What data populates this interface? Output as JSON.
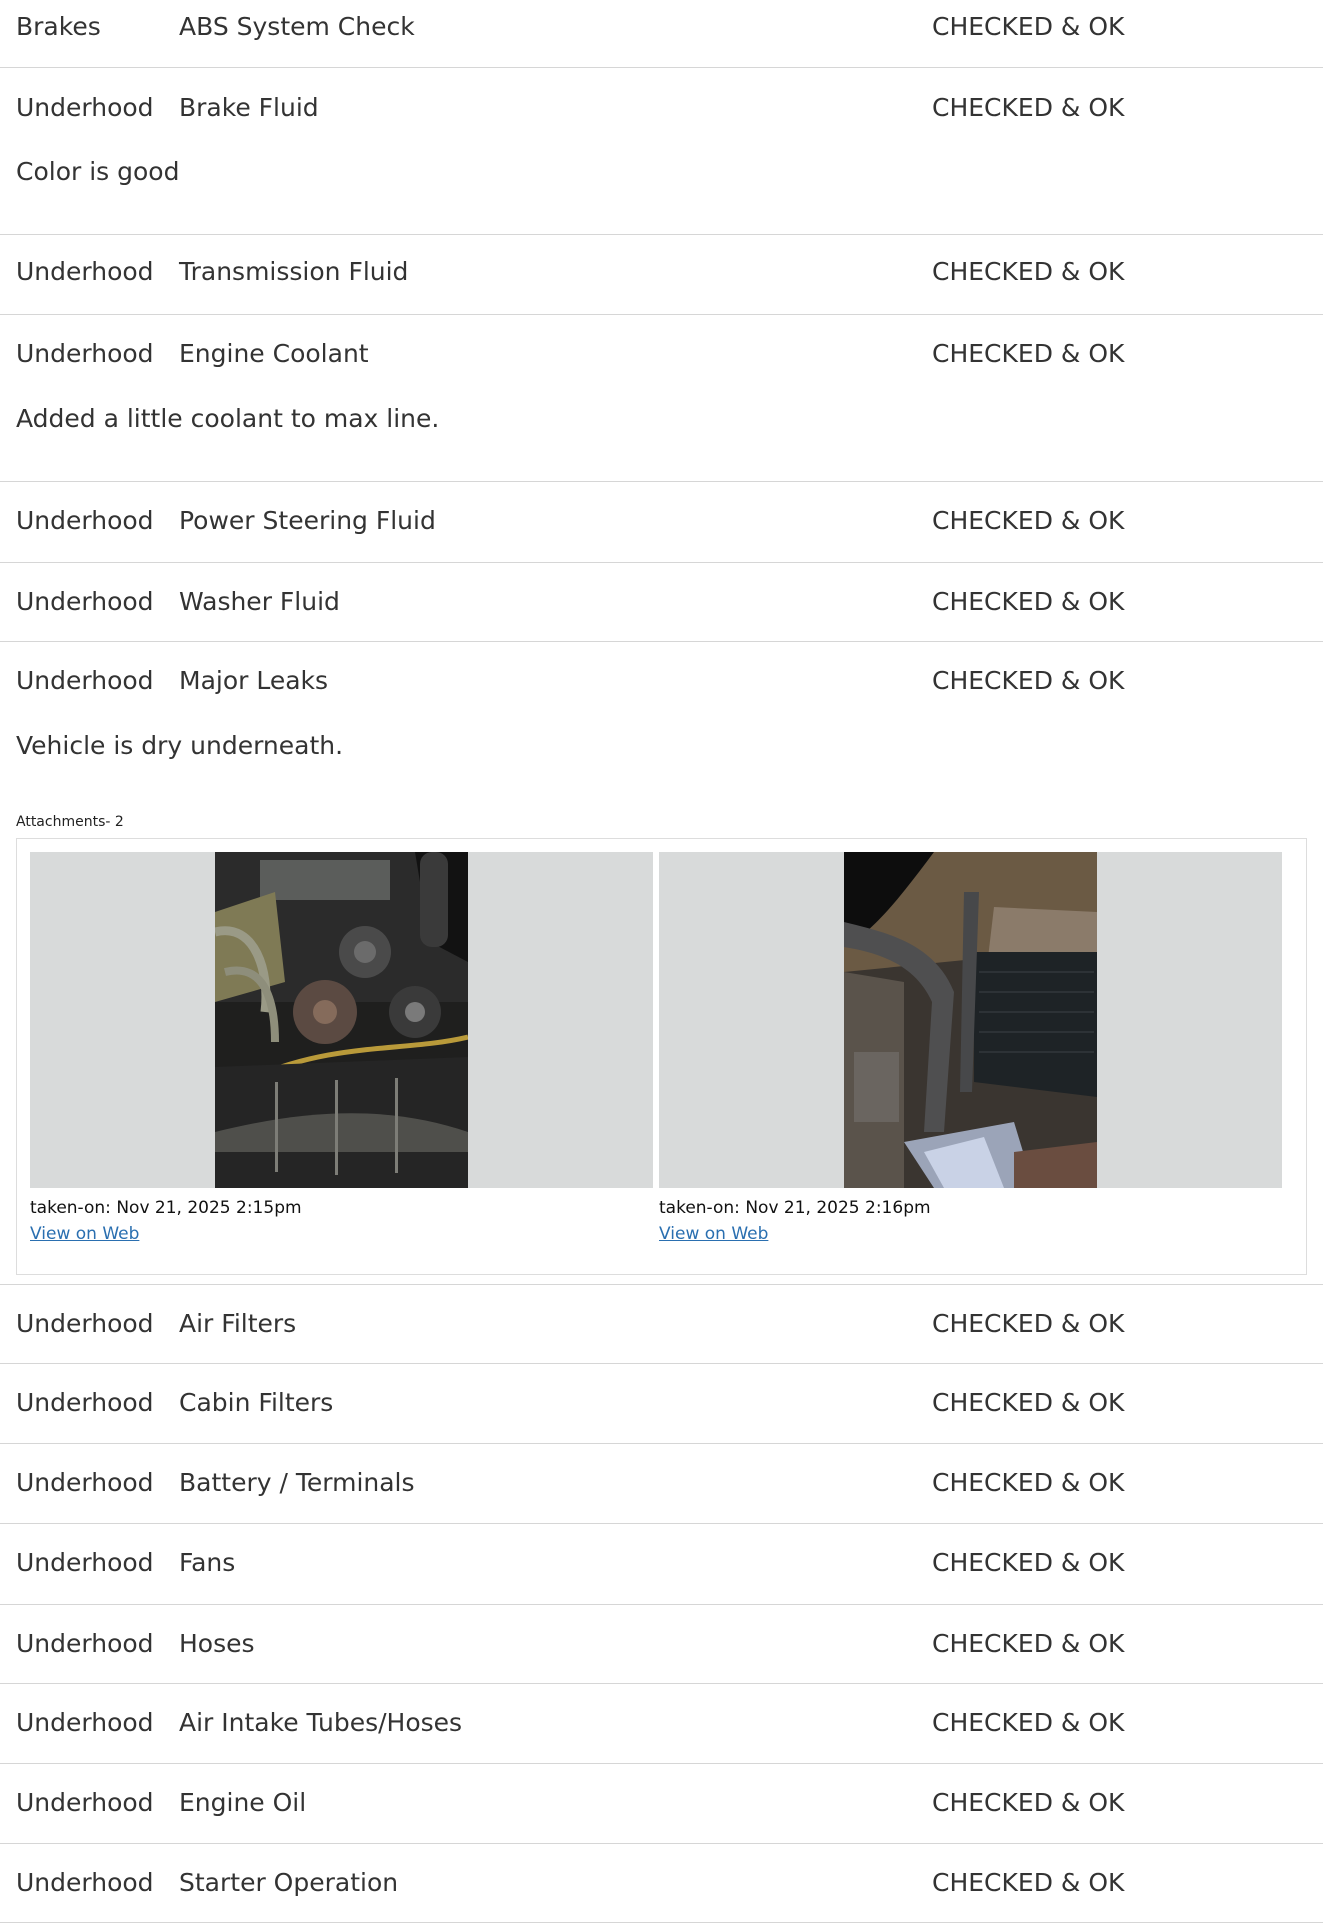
{
  "rows_top": [
    {
      "category": "Brakes",
      "item": "ABS System Check",
      "status": "CHECKED & OK",
      "note": ""
    },
    {
      "category": "Underhood",
      "item": "Brake Fluid",
      "status": "CHECKED & OK",
      "note": "Color is good"
    },
    {
      "category": "Underhood",
      "item": "Transmission Fluid",
      "status": "CHECKED & OK",
      "note": ""
    },
    {
      "category": "Underhood",
      "item": "Engine Coolant",
      "status": "CHECKED & OK",
      "note": "Added a little coolant to max line."
    },
    {
      "category": "Underhood",
      "item": "Power Steering Fluid",
      "status": "CHECKED & OK",
      "note": ""
    },
    {
      "category": "Underhood",
      "item": "Washer Fluid",
      "status": "CHECKED & OK",
      "note": ""
    },
    {
      "category": "Underhood",
      "item": "Major Leaks",
      "status": "CHECKED & OK",
      "note": "Vehicle is dry underneath."
    }
  ],
  "attachments": {
    "label": "Attachments- 2",
    "items": [
      {
        "taken_label": "taken-on:",
        "taken_value": "Nov 21, 2025 2:15pm",
        "link_text": "View on Web"
      },
      {
        "taken_label": "taken-on:",
        "taken_value": "Nov 21, 2025 2:16pm",
        "link_text": "View on Web"
      }
    ]
  },
  "rows_bottom": [
    {
      "category": "Underhood",
      "item": "Air Filters",
      "status": "CHECKED & OK"
    },
    {
      "category": "Underhood",
      "item": "Cabin Filters",
      "status": "CHECKED & OK"
    },
    {
      "category": "Underhood",
      "item": "Battery / Terminals",
      "status": "CHECKED & OK"
    },
    {
      "category": "Underhood",
      "item": "Fans",
      "status": "CHECKED & OK"
    },
    {
      "category": "Underhood",
      "item": "Hoses",
      "status": "CHECKED & OK"
    },
    {
      "category": "Underhood",
      "item": "Air Intake Tubes/Hoses",
      "status": "CHECKED & OK"
    },
    {
      "category": "Underhood",
      "item": "Engine Oil",
      "status": "CHECKED & OK"
    },
    {
      "category": "Underhood",
      "item": "Starter Operation",
      "status": "CHECKED & OK"
    }
  ]
}
